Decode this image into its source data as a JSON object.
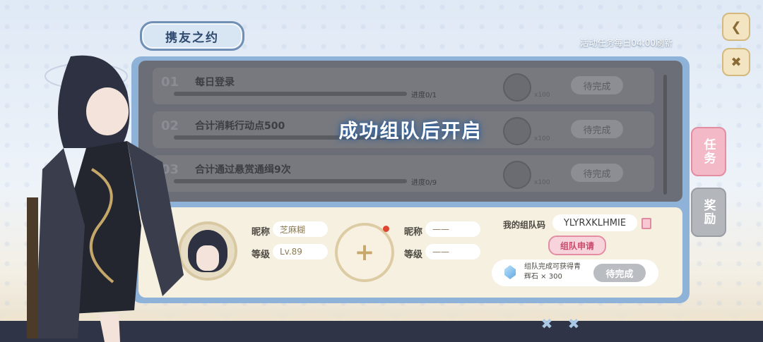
{
  "header": {
    "title": "携友之约",
    "refresh_note": "活动任务每日04:00刷新"
  },
  "locked_message": "成功组队后开启",
  "tasks": [
    {
      "num": "01",
      "name": "每日登录",
      "progress": "进度0/1",
      "reward_amount": "x100",
      "button": "待完成"
    },
    {
      "num": "02",
      "name": "合计消耗行动点500",
      "progress": "",
      "reward_amount": "x100",
      "button": "待完成"
    },
    {
      "num": "03",
      "name": "合计通过悬赏通缉9次",
      "progress": "进度0/9",
      "reward_amount": "x100",
      "button": "待完成"
    }
  ],
  "side_tabs": {
    "tasks": "任务",
    "rewards": "奖励"
  },
  "team": {
    "member1": {
      "nickname_label": "昵称",
      "nickname": "芝麻糊",
      "level_label": "等级",
      "level": "Lv.89"
    },
    "member2": {
      "nickname_label": "昵称",
      "nickname": "——",
      "level_label": "等级",
      "level": "——"
    },
    "add_icon": "+",
    "code_label": "我的组队码",
    "code": "YLYRXKLHMIE",
    "apply_button": "组队申请",
    "reward_line1": "组队完成可获得青",
    "reward_line2": "辉石 × 300",
    "reward_button": "待完成"
  },
  "colors": {
    "accent_pink": "#e28da2",
    "panel_blue": "#8fb3d8",
    "cream": "#f6f0e1"
  }
}
